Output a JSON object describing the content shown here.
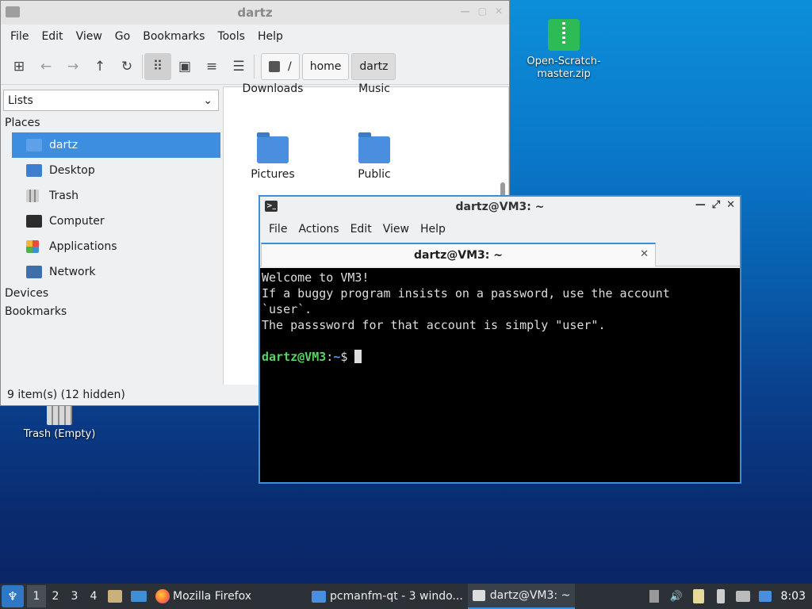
{
  "desktop": {
    "zip_icon_label": "Open-Scratch-master.zip",
    "trash_label": "Trash (Empty)"
  },
  "file_manager": {
    "title": "dartz",
    "menu": [
      "File",
      "Edit",
      "View",
      "Go",
      "Bookmarks",
      "Tools",
      "Help"
    ],
    "breadcrumb": [
      "/",
      "home",
      "dartz"
    ],
    "side_select": "Lists",
    "places_header": "Places",
    "places": [
      "dartz",
      "Desktop",
      "Trash",
      "Computer",
      "Applications",
      "Network"
    ],
    "devices_header": "Devices",
    "bookmarks_header": "Bookmarks",
    "folders_top": [
      "Downloads",
      "Music"
    ],
    "folders": [
      "Pictures",
      "Public"
    ],
    "status": "9 item(s) (12 hidden)"
  },
  "terminal": {
    "title": "dartz@VM3: ~",
    "menu": [
      "File",
      "Actions",
      "Edit",
      "View",
      "Help"
    ],
    "tab_label": "dartz@VM3: ~",
    "lines": [
      "Welcome to VM3!",
      "If a buggy program insists on a password, use the account",
      "`user`.",
      "The passsword for that account is simply \"user\"."
    ],
    "prompt_user": "dartz@VM3",
    "prompt_sep": ":",
    "prompt_path": "~",
    "prompt_symbol": "$ "
  },
  "taskbar": {
    "workspaces": [
      "1",
      "2",
      "3",
      "4"
    ],
    "tasks": [
      "Mozilla Firefox",
      "pcmanfm-qt - 3 windo...",
      "dartz@VM3: ~"
    ],
    "clock": "8:03"
  }
}
